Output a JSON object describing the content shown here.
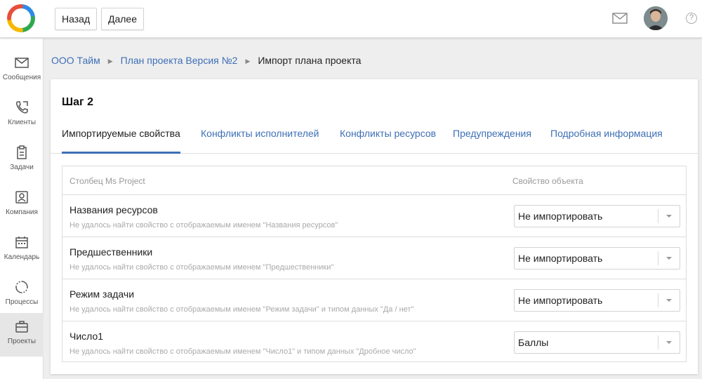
{
  "header": {
    "back_label": "Назад",
    "next_label": "Далее",
    "help_label": "?"
  },
  "sidebar": {
    "items": [
      {
        "label": "Сообщения",
        "icon": "mail-icon"
      },
      {
        "label": "Клиенты",
        "icon": "phone-icon"
      },
      {
        "label": "Задачи",
        "icon": "clipboard-icon"
      },
      {
        "label": "Компания",
        "icon": "company-icon"
      },
      {
        "label": "Календарь",
        "icon": "calendar-icon"
      },
      {
        "label": "Процессы",
        "icon": "process-icon"
      },
      {
        "label": "Проекты",
        "icon": "briefcase-icon",
        "active": true
      }
    ]
  },
  "breadcrumb": {
    "items": [
      "ООО Тайм",
      "План проекта Версия №2"
    ],
    "current": "Импорт плана проекта"
  },
  "step_title": "Шаг 2",
  "tabs": [
    {
      "label": "Импортируемые свойства",
      "active": true
    },
    {
      "label": "Конфликты исполнителей"
    },
    {
      "label": "Конфликты ресурсов"
    },
    {
      "label": "Предупреждения"
    },
    {
      "label": "Подробная информация"
    }
  ],
  "table": {
    "headers": [
      "Столбец Ms Project",
      "Свойство объекта"
    ],
    "rows": [
      {
        "name": "Названия ресурсов",
        "desc": "Не удалось найти свойство с отображаемым именем \"Названия ресурсов\"",
        "value": "Не импортировать"
      },
      {
        "name": "Предшественники",
        "desc": "Не удалось найти свойство с отображаемым именем \"Предшественники\"",
        "value": "Не импортировать"
      },
      {
        "name": "Режим задачи",
        "desc": "Не удалось найти свойство с отображаемым именем \"Режим задачи\" и типом данных \"Да / нет\"",
        "value": "Не импортировать"
      },
      {
        "name": "Число1",
        "desc": "Не удалось найти свойство с отображаемым именем \"Число1\" и типом данных \"Дробное число\"",
        "value": "Баллы"
      }
    ]
  },
  "colors": {
    "link": "#3d6fb6",
    "active_tab_underline": "#3d6fb6",
    "logo": [
      "#e94e3c",
      "#f6b900",
      "#2fa84f",
      "#2d8be5"
    ]
  }
}
